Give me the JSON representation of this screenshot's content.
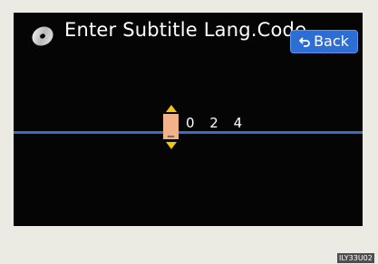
{
  "header": {
    "title": "Enter Subtitle Lang.Code",
    "icon": "disc-icon",
    "back_label": "Back",
    "back_icon": "return-arrow-icon",
    "back_color": "#2d6ed4"
  },
  "code_entry": {
    "cursor_value": "_",
    "digits": "0 2 4",
    "up_icon": "triangle-up-icon",
    "down_icon": "triangle-down-icon",
    "arrow_color": "#f2c417",
    "cursor_color": "#f3b38a"
  },
  "footer": {
    "image_code": "ILY33U02"
  },
  "colors": {
    "screen_background": "#050505",
    "divider": "#3b6cc0",
    "frame": "#ecebe3"
  }
}
